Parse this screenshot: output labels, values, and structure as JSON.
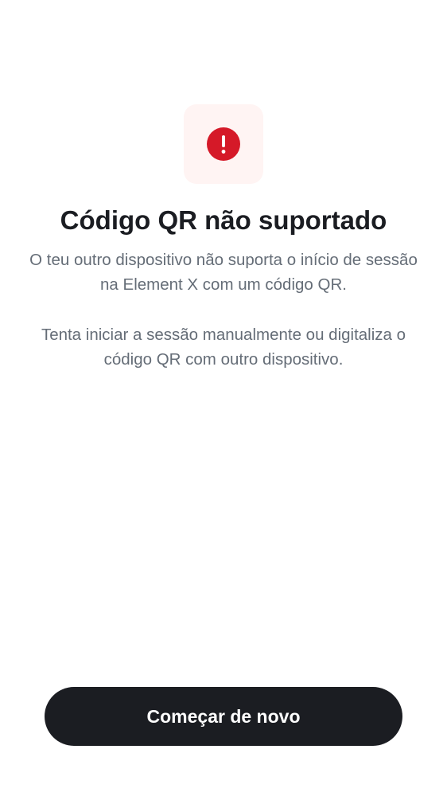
{
  "error": {
    "icon": "error-exclamation-icon",
    "icon_color": "#d51928",
    "icon_background": "#fff4f3",
    "title": "Código QR não suportado",
    "paragraph_1": "O teu outro dispositivo não suporta o início de sessão na Element X com um código QR.",
    "paragraph_2": "Tenta iniciar a sessão manualmente ou digitaliza o código QR com outro dispositivo."
  },
  "actions": {
    "start_over_label": "Começar de novo",
    "button_color": "#1b1d22"
  }
}
